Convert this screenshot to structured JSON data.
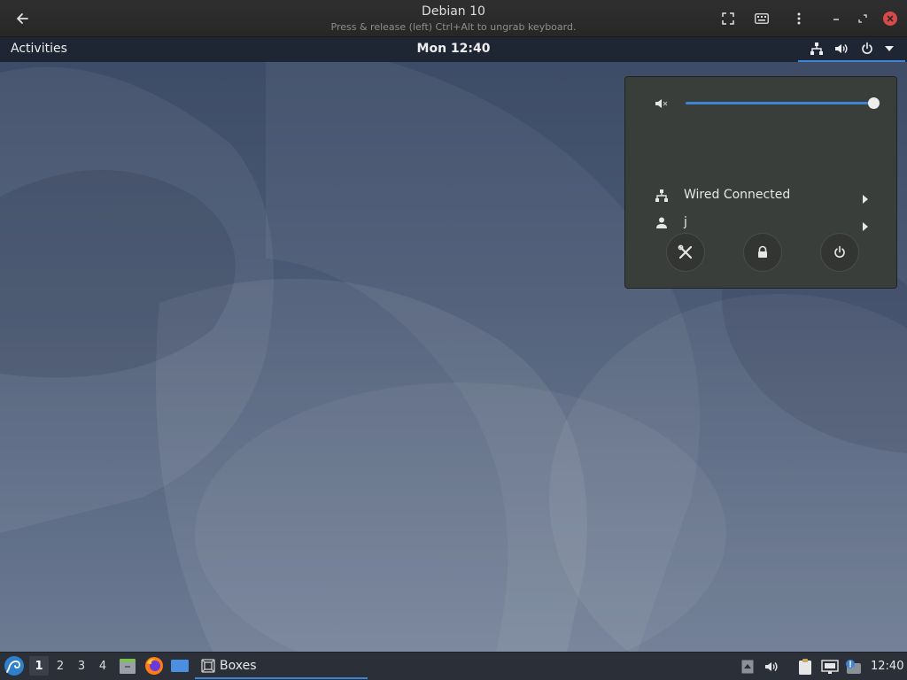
{
  "app_window": {
    "title": "Debian 10",
    "subtitle": "Press & release (left) Ctrl+Alt to ungrab keyboard."
  },
  "top_bar": {
    "activities_label": "Activities",
    "clock": "Mon 12:40"
  },
  "system_menu": {
    "volume_level": 1.0,
    "wired_label": "Wired Connected",
    "user_label": "j"
  },
  "taskbar": {
    "workspaces": [
      "1",
      "2",
      "3",
      "4"
    ],
    "active_workspace": "1",
    "task_label": "Boxes",
    "clock": "12:40"
  },
  "colors": {
    "accent": "#3f84d4",
    "close_button": "#d84a4a",
    "top_bar": "#1e2533",
    "menu_background": "#3a3e3a"
  },
  "icons": {
    "header": [
      "back-arrow-icon",
      "fullscreen-icon",
      "keyboard-icon",
      "more-icon",
      "minimize-icon",
      "restore-icon",
      "close-icon"
    ],
    "top_bar": [
      "network-wired-icon",
      "volume-icon",
      "power-icon",
      "dropdown-arrow-icon"
    ],
    "menu": [
      "volume-muted-icon",
      "network-wired-icon",
      "user-icon",
      "settings-icon",
      "lock-icon",
      "power-off-icon"
    ],
    "taskbar": [
      "start-menu-icon",
      "files-icon",
      "firefox-icon",
      "show-desktop-icon",
      "boxes-icon",
      "tray-arrow-icon",
      "tray-volume-icon",
      "clipboard-icon",
      "network-icon",
      "notification-icon"
    ]
  }
}
